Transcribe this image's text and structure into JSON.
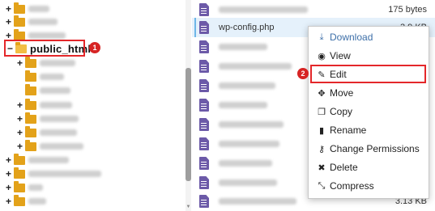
{
  "tree": {
    "selected_folder": "public_html",
    "toggles": {
      "expand": "+",
      "collapse": "−"
    }
  },
  "badges": {
    "step1": "1",
    "step2": "2"
  },
  "files": {
    "row0_size": "175 bytes",
    "selected_name": "wp-config.php",
    "selected_size_partial": "3.9 KB",
    "last_size": "3.13 KB"
  },
  "context_menu": {
    "items": [
      {
        "label": "Download",
        "icon": "download-icon"
      },
      {
        "label": "View",
        "icon": "eye-icon"
      },
      {
        "label": "Edit",
        "icon": "pencil-icon"
      },
      {
        "label": "Move",
        "icon": "move-arrows-icon"
      },
      {
        "label": "Copy",
        "icon": "copy-icon"
      },
      {
        "label": "Rename",
        "icon": "file-icon"
      },
      {
        "label": "Change Permissions",
        "icon": "key-icon"
      },
      {
        "label": "Delete",
        "icon": "x-icon"
      },
      {
        "label": "Compress",
        "icon": "compress-icon"
      }
    ]
  },
  "colors": {
    "highlight_red": "#e4272a",
    "folder": "#e3a21a",
    "file_icon": "#6c5aa8",
    "selected_row": "#e5f1fb",
    "link_blue": "#3d6fa8"
  }
}
